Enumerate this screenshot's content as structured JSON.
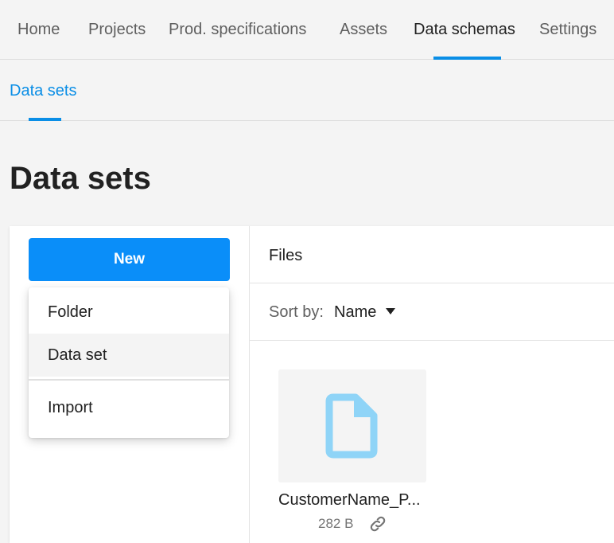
{
  "top_nav": {
    "tabs": [
      {
        "label": "Home"
      },
      {
        "label": "Projects"
      },
      {
        "label": "Prod. specifications"
      },
      {
        "label": "Assets"
      },
      {
        "label": "Data schemas",
        "active": true
      },
      {
        "label": "Settings"
      }
    ]
  },
  "sub_nav": {
    "tabs": [
      {
        "label": "Data sets",
        "active": true
      }
    ]
  },
  "page": {
    "title": "Data sets"
  },
  "left_pane": {
    "new_button_label": "New",
    "menu": {
      "items": [
        {
          "label": "Folder"
        },
        {
          "label": "Data set",
          "hovered": true
        },
        {
          "label": "Import"
        }
      ]
    }
  },
  "files": {
    "header": "Files",
    "sort_label": "Sort by:",
    "sort_value": "Name",
    "items": [
      {
        "name": "CustomerName_P...",
        "size": "282 B",
        "icon": "file-icon"
      }
    ]
  },
  "colors": {
    "accent": "#0a8ee6",
    "button": "#0a8ef9",
    "file_icon": "#8fd4f7"
  }
}
